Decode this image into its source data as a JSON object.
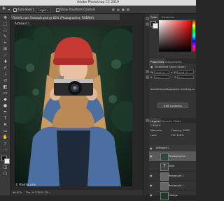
{
  "window": {
    "title": "Adobe Photoshop CC 2019"
  },
  "options_bar": {
    "auto_select_label": "Auto-Select:",
    "auto_select_value": "Layer",
    "show_transform_label": "Show Transform Controls"
  },
  "document": {
    "tab_title": "Filelnfo.com Example.psd @ 66% (Photographer, RGB/8#)",
    "artboard_label": "Artboard 1",
    "watermark": "© Filelnfo.com"
  },
  "status_bar": {
    "zoom": "66.67%",
    "doc_size": "Doc: 8.77M/34.1M"
  },
  "color_panel": {
    "tabs": [
      "Color",
      "Swatches"
    ],
    "active_tab": "Color",
    "accent_hex": "#ff0000"
  },
  "properties_panel": {
    "tabs": [
      "Properties",
      "Adjustments"
    ],
    "active_tab": "Properties",
    "object_type": "Embedded Smart Object",
    "width_label": "W:",
    "width_value": "1528 px",
    "height_label": "H:",
    "height_value": "1528 px",
    "x_label": "X:",
    "x_value": "0 px",
    "y_label": "Y:",
    "y_value": "0 px",
    "filename": "beautiful-photographer-is-taking-a-pict...",
    "edit_button": "Edit Contents"
  },
  "layers_panel": {
    "tabs": [
      "Layers",
      "Channels",
      "Paths"
    ],
    "active_tab": "Layers",
    "kind_filter": "Kind",
    "blend_mode": "Normal",
    "opacity_label": "Opacity:",
    "opacity_value": "100%",
    "lock_label": "Lock:",
    "fill_label": "Fill:",
    "fill_value": "100%",
    "artboard_name": "Artboard 1",
    "layers": [
      {
        "name": "Photographer",
        "selected": true,
        "visible": true
      },
      {
        "name": "Title",
        "selected": false,
        "visible": false
      },
      {
        "name": "Rectangle 1",
        "selected": false,
        "visible": true
      },
      {
        "name": "Rectangle 1",
        "selected": false,
        "visible": true
      },
      {
        "name": "Foliage",
        "selected": false,
        "visible": true
      }
    ]
  }
}
